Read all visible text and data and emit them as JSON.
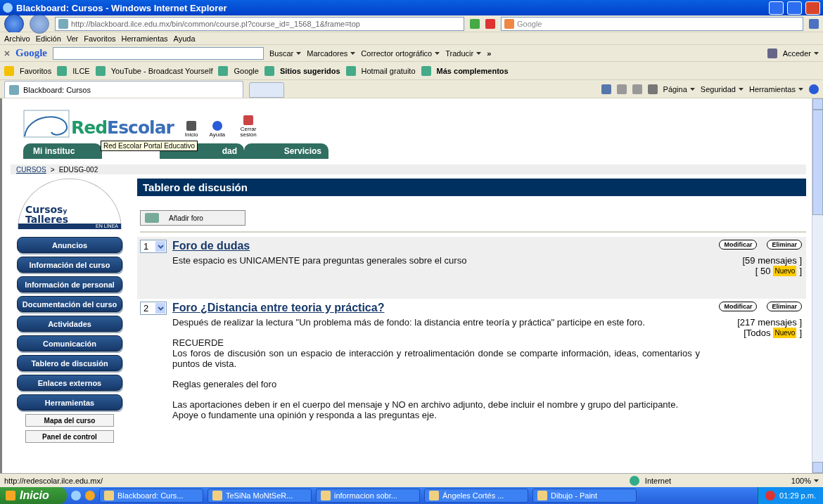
{
  "window": {
    "title": "Blackboard: Cursos - Windows Internet Explorer"
  },
  "address": {
    "url": "http://blackboard.ilce.edu.mx/bin/common/course.pl?course_id=_1568_1&frame=top",
    "search_placeholder": "Google"
  },
  "menu": [
    "Archivo",
    "Edición",
    "Ver",
    "Favoritos",
    "Herramientas",
    "Ayuda"
  ],
  "google_toolbar": {
    "brand": "Google",
    "items": [
      "Buscar",
      "Marcadores",
      "Corrector ortográfico",
      "Traducir"
    ],
    "more": "»",
    "signin": "Acceder"
  },
  "favorites": [
    {
      "label": "Favoritos",
      "bold": false
    },
    {
      "label": "ILCE",
      "bold": false
    },
    {
      "label": "YouTube - Broadcast Yourself",
      "bold": false
    },
    {
      "label": "Google",
      "bold": false
    },
    {
      "label": "Sitios sugeridos",
      "bold": true
    },
    {
      "label": "Hotmail gratuito",
      "bold": false
    },
    {
      "label": "Más complementos",
      "bold": true
    }
  ],
  "browser_tab": "Blackboard: Cursos",
  "command_bar": [
    "Página",
    "Seguridad",
    "Herramientas"
  ],
  "page": {
    "logo": {
      "part1": "Red",
      "part2": "Escolar"
    },
    "header_links": [
      "Inicio",
      "Ayuda",
      "Cerrar sesión"
    ],
    "tabs": [
      {
        "label": "Mi instituc",
        "selected": false
      },
      {
        "selected": true
      },
      {
        "label": "dad",
        "selected": false
      },
      {
        "label": "Servicios",
        "selected": false
      }
    ],
    "tooltip": "Red Escolar Portal Educativo",
    "breadcrumb": {
      "link": "CURSOS",
      "separator": ">",
      "current": "EDUSG-002"
    },
    "side_logo": {
      "line1": "Cursos",
      "small": "y",
      "line2": "Talleres",
      "band": "EN LÍNEA"
    },
    "sidebar": [
      {
        "label": "Anuncios",
        "kind": "main"
      },
      {
        "label": "Información del curso",
        "kind": "main"
      },
      {
        "label": "Información de personal",
        "kind": "main"
      },
      {
        "label": "Documentación del curso",
        "kind": "main"
      },
      {
        "label": "Actividades",
        "kind": "main"
      },
      {
        "label": "Comunicación",
        "kind": "main"
      },
      {
        "label": "Tablero de discusión",
        "kind": "main"
      },
      {
        "label": "Enlaces externos",
        "kind": "main"
      },
      {
        "label": "Herramientas",
        "kind": "main"
      },
      {
        "label": "Mapa del curso",
        "kind": "sub"
      },
      {
        "label": "Panel de control",
        "kind": "sub"
      }
    ],
    "title": "Tablero de discusión",
    "add_button": "Añadir foro",
    "forums": [
      {
        "number": "1",
        "title": "Foro de dudas",
        "shaded": true,
        "edit": "Modificar",
        "delete": "Eliminar",
        "messages": "[59 mensajes ]",
        "new_prefix": "[ 50",
        "new_badge": "Nuevo",
        "new_suffix": "]",
        "paragraphs": [
          [
            "Este espacio es UNICAMENTE para preguntas generales sobre el curso"
          ]
        ]
      },
      {
        "number": "2",
        "title": "Foro ¿Distancia entre teoria y práctica?",
        "shaded": false,
        "edit": "Modificar",
        "delete": "Eliminar",
        "messages": "[217 mensajes ]",
        "new_prefix": "[Todos",
        "new_badge": "Nuevo",
        "new_suffix": "]",
        "paragraphs": [
          [
            "Después de realizar la lectura \"Un problema más de fondo: la distancia entre teoría y práctica\" participe en este foro."
          ],
          [
            "RECUERDE",
            "Los foros de discusión son un espacio de interacción y retroalimentación donde se comparte información, ideas, comentarios y puntos de vista."
          ],
          [
            "Reglas generales del foro"
          ],
          [
            "Las aportaciones deben ir en el cuerpo del mensaje y NO en archivo adjunto, debe incluir el nombre y grupo del participante.",
            "Apoye o fundamente una opinión y responda a las preguntas eje."
          ]
        ]
      }
    ]
  },
  "status_bar": {
    "url": "http://redescolar.ilce.edu.mx/",
    "zone": "Internet",
    "zoom": "100%"
  },
  "taskbar": {
    "start": "Inicio",
    "tasks": [
      "Blackboard: Curs...",
      "TeSiNa MoNtSeR...",
      "informacion sobr...",
      "Ángeles Cortés ...",
      "Dibujo - Paint"
    ],
    "clock": "01:29 p.m."
  }
}
